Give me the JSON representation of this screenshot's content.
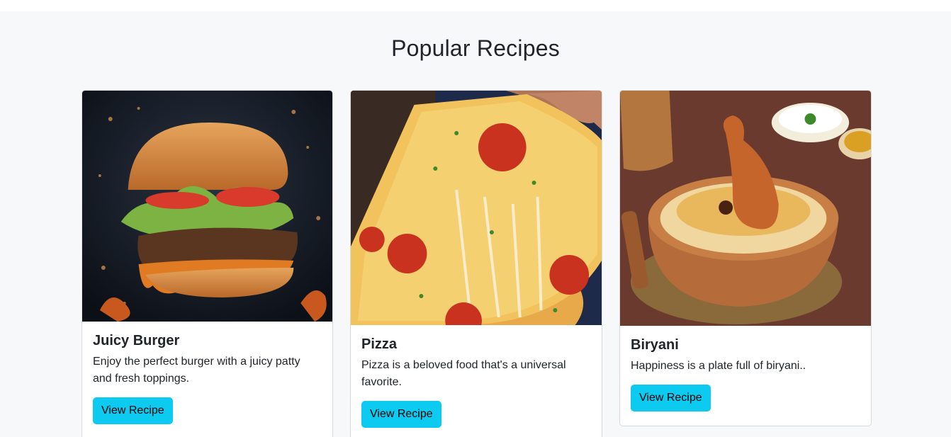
{
  "section": {
    "title": "Popular Recipes"
  },
  "recipes": [
    {
      "title": "Juicy Burger",
      "description": "Enjoy the perfect burger with a juicy patty and fresh toppings.",
      "button_label": "View Recipe",
      "image": "burger-photo"
    },
    {
      "title": "Pizza",
      "description": "Pizza is a beloved food that's a universal favorite.",
      "button_label": "View Recipe",
      "image": "pizza-photo"
    },
    {
      "title": "Biryani",
      "description": "Happiness is a plate full of biryani..",
      "button_label": "View Recipe",
      "image": "biryani-photo"
    }
  ],
  "colors": {
    "accent": "#0dcaf0",
    "section_bg": "#f7f8fa"
  }
}
